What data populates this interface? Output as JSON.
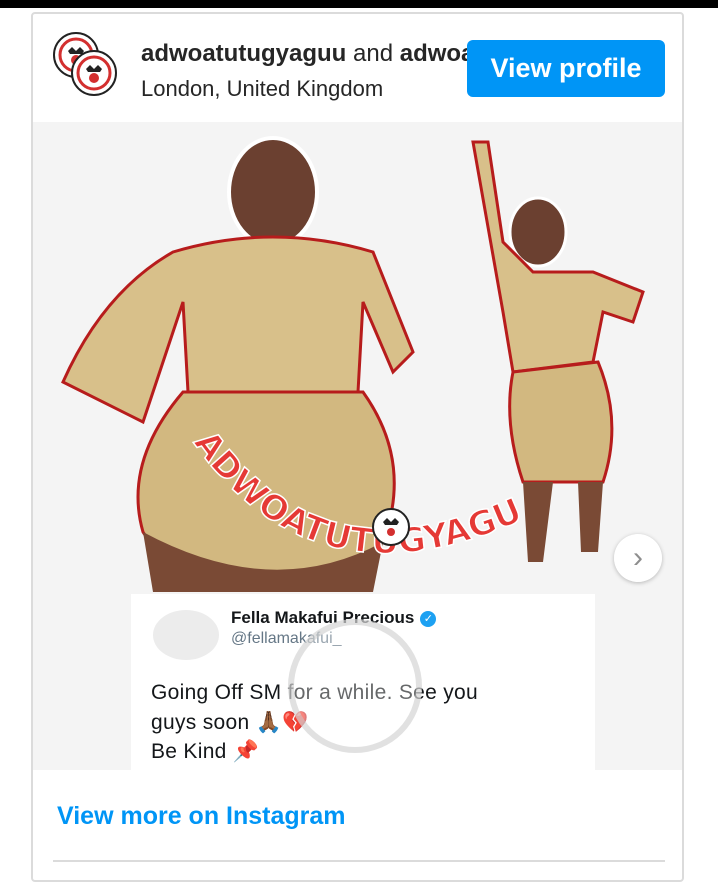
{
  "header": {
    "handle_primary": "adwoatutugyaguu",
    "handle_join": " and ",
    "handle_secondary": "adwoatutugyaguu",
    "location": "London, United Kingdom",
    "view_profile_label": "View profile"
  },
  "media": {
    "overlay_text": "ADWOATUTUGYAGU",
    "tweet": {
      "name": "Fella Makafui Precious",
      "handle": "@fellamakafui_",
      "line1": "Going Off SM for a while. See you",
      "line2": "guys soon 🙏🏾💔",
      "line3": "Be Kind 📌"
    }
  },
  "footer": {
    "view_more_label": "View more on Instagram"
  },
  "colors": {
    "accent": "#0095f6",
    "overlay_text": "#e53935",
    "outfit": "#d8c08a"
  }
}
